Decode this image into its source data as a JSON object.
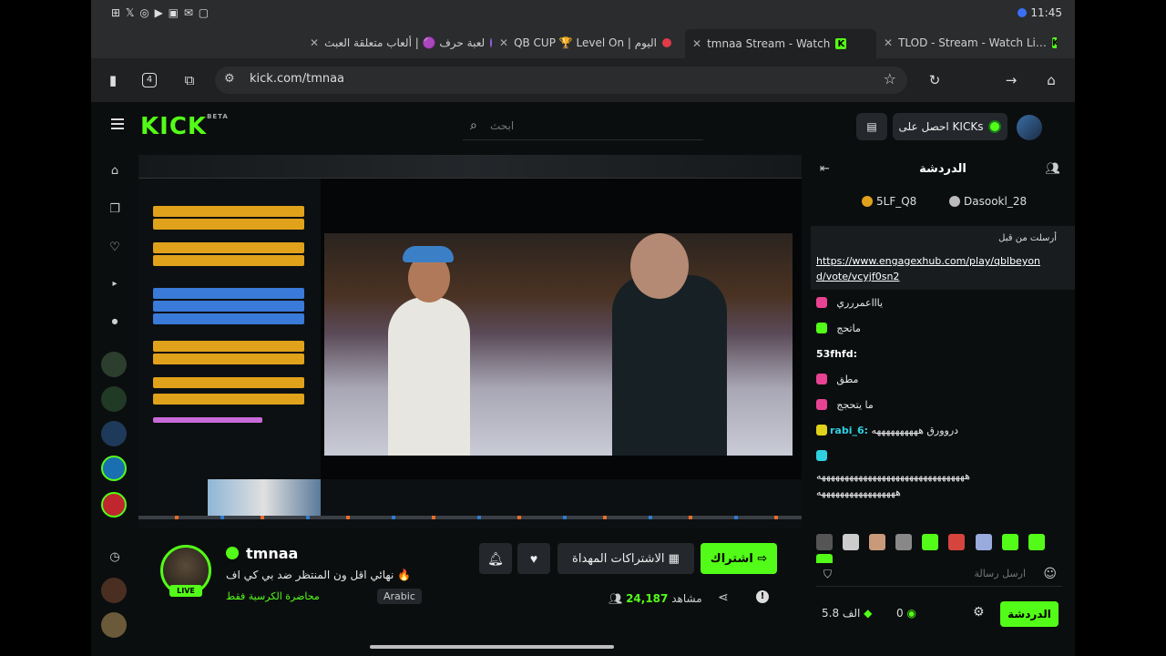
{
  "status": {
    "left": "⊞ 𝕏 ◎ ▶ ▣ ✉ ▢",
    "time": "11:45"
  },
  "tabs": [
    {
      "title": "TLOD - Stream - Watch Li…"
    },
    {
      "title": "tmnaa Stream - Watch"
    },
    {
      "title": "QB CUP 🏆 Level On | اليوم"
    },
    {
      "title": "لعبة حرف 🟣 | ألعاب متعلقة العبث"
    }
  ],
  "address": {
    "url": "kick.com/tmnaa",
    "tab_count": "4"
  },
  "header": {
    "logo": "KICK",
    "logo_beta": "BETA",
    "search_placeholder": "ابحث",
    "kicks_button": "احصل على KICKs"
  },
  "video": {},
  "streamer": {
    "name": "tmnaa",
    "title": "نهائي اقل ون المنتظر ضد بي كي اف 🔥",
    "category": "محاضرة الكرسية فقط",
    "language": "Arabic",
    "viewers": "24,187",
    "viewers_label": "مشاهد",
    "subscribe_label": "اشتراك",
    "gift_subs_label": "الاشتراكات المهداة"
  },
  "chat": {
    "title": "الدردشة",
    "pinned_users": [
      "5LF_Q8",
      "Dasookl_28"
    ],
    "pinned_meta": "أرسلت من قبل",
    "pinned_link": "https://www.engagexhub.com/play/qblbeyond/vote/vcyjf0sn2",
    "messages": [
      {
        "user": "",
        "text": "ياااعمررري"
      },
      {
        "user": "",
        "text": "ماتحج"
      },
      {
        "user": "53fhfd:",
        "text": ""
      },
      {
        "user": "",
        "text": "مطق"
      },
      {
        "user": "",
        "text": "ما يتحجج"
      },
      {
        "user": "rabi_6:",
        "text": "دروورق ههههههههههه"
      },
      {
        "user": "",
        "text": ""
      },
      {
        "user": "",
        "text": "ههههههههههههههههههههههههههههههههه"
      },
      {
        "user": "",
        "text": "هههههههههههههههههه"
      }
    ],
    "input_placeholder": "ارسل رسالة",
    "kicks_count": "5.8 الف",
    "points": "0",
    "send_label": "الدردشة"
  },
  "colors": {
    "accent": "#53fc18",
    "bg": "#0b0e0f",
    "panel": "#24272c"
  }
}
